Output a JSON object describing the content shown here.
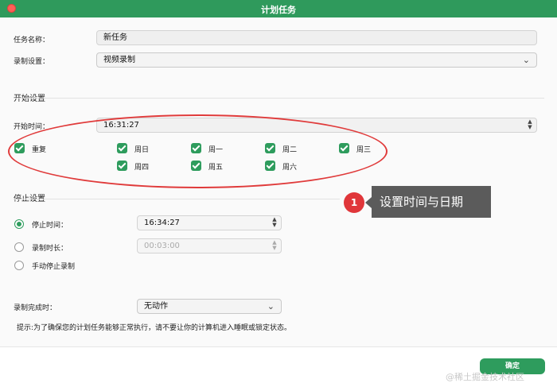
{
  "window": {
    "title": "计划任务"
  },
  "form": {
    "task_name_label": "任务名称：",
    "task_name_value": "新任务",
    "record_setting_label": "录制设置：",
    "record_setting_value": "视频录制"
  },
  "start": {
    "section_title": "开始设置",
    "start_time_label": "开始时间：",
    "start_time_value": "16:31:27",
    "repeat_label": "重复",
    "days": [
      "周日",
      "周一",
      "周二",
      "周三",
      "周四",
      "周五",
      "周六"
    ],
    "all_checked": true
  },
  "stop": {
    "section_title": "停止设置",
    "stop_time_label": "停止时间：",
    "stop_time_value": "16:34:27",
    "duration_label": "录制时长：",
    "duration_value": "00:03:00",
    "manual_label": "手动停止录制",
    "selected_option": "停止时间"
  },
  "after": {
    "label": "录制完成时：",
    "value": "无动作"
  },
  "tip": "提示:为了确保您的计划任务能够正常执行，请不要让你的计算机进入睡眠或锁定状态。",
  "callout": {
    "number": "1",
    "text": "设置时间与日期"
  },
  "buttons": {
    "ok": "确定"
  },
  "watermark": "@稀土掘金技术社区",
  "colors": {
    "accent": "#2e9c5d",
    "titlebar": "#2f9a5c",
    "annotation": "#e0363a"
  }
}
